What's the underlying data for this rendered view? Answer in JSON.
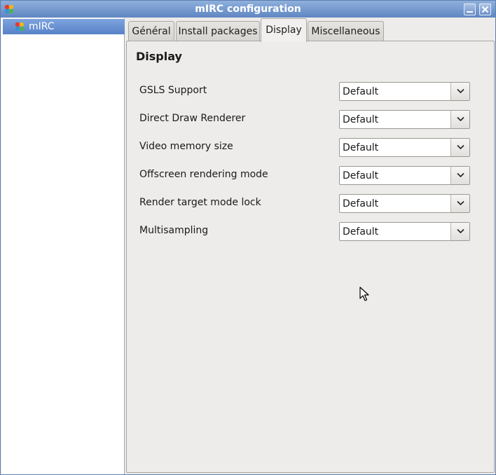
{
  "window": {
    "title": "mIRC configuration",
    "minimize_icon": "minimize-icon",
    "close_icon": "close-icon"
  },
  "sidebar": {
    "items": [
      {
        "label": "mIRC",
        "icon": "mirc-logo-icon",
        "selected": true
      }
    ]
  },
  "tabs": [
    {
      "label": "Général",
      "active": false
    },
    {
      "label": "Install packages",
      "active": false
    },
    {
      "label": "Display",
      "active": true
    },
    {
      "label": "Miscellaneous",
      "active": false
    }
  ],
  "section": {
    "title": "Display",
    "settings": [
      {
        "label": "GSLS Support",
        "value": "Default"
      },
      {
        "label": "Direct Draw Renderer",
        "value": "Default"
      },
      {
        "label": "Video memory size",
        "value": "Default"
      },
      {
        "label": "Offscreen rendering mode",
        "value": "Default"
      },
      {
        "label": "Render target mode lock",
        "value": "Default"
      },
      {
        "label": "Multisampling",
        "value": "Default"
      }
    ]
  },
  "colors": {
    "titlebar": "#6f92c9",
    "selection": "#6a93d3",
    "panel_bg": "#edeceb"
  }
}
